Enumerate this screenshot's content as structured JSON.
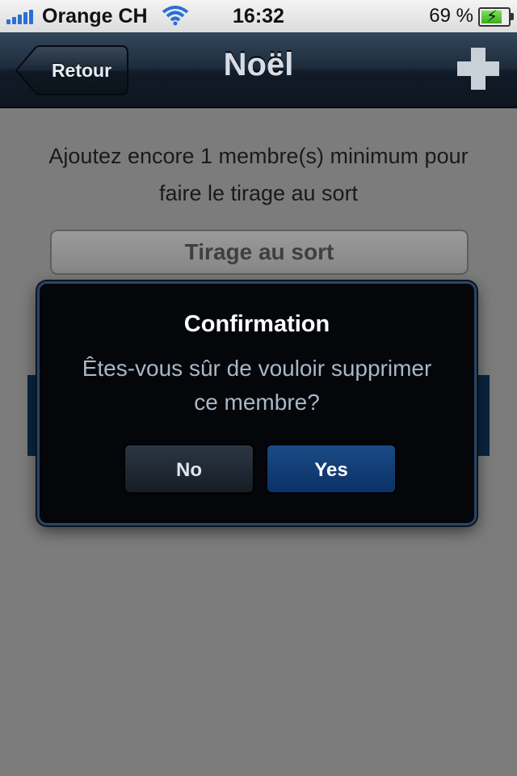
{
  "status_bar": {
    "carrier": "Orange CH",
    "time": "16:32",
    "battery_percent": "69 %",
    "battery_level": 0.69,
    "signal_icon": "signal-bars-icon",
    "wifi_icon": "wifi-icon",
    "battery_icon": "battery-charging-icon"
  },
  "navbar": {
    "back_label": "Retour",
    "title": "Noël",
    "add_icon": "plus-icon"
  },
  "content": {
    "hint": "Ajoutez encore 1 membre(s) minimum pour faire le tirage au sort",
    "draw_button": "Tirage au sort"
  },
  "alert": {
    "title": "Confirmation",
    "message": "Êtes-vous sûr de vouloir supprimer ce membre?",
    "no_label": "No",
    "yes_label": "Yes"
  },
  "colors": {
    "navbar": "#1d2c3c",
    "alert_border": "#2b4563",
    "yes_button": "#1a4b86",
    "backdrop": "#7c7c7c"
  }
}
